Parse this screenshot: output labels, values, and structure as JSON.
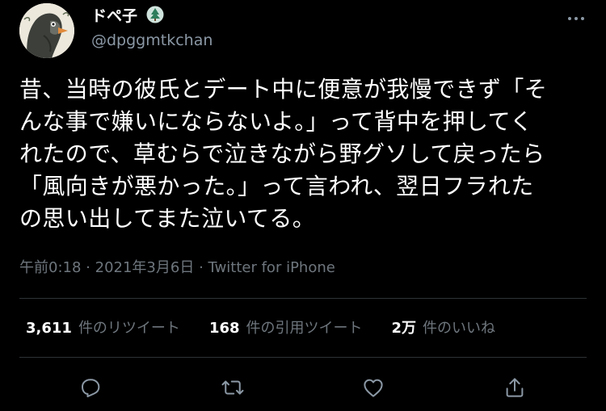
{
  "user": {
    "display_name": "ドペ子",
    "handle": "@dpggmtkchan"
  },
  "tweet": {
    "lines": [
      "昔、当時の彼氏とデート中に便意が我慢できず「そ",
      "んな事で嫌いにならないよ。」って背中を押してく",
      "れたので、草むらで泣きながら野グソして戻ったら",
      "「風向きが悪かった。」って言われ、翌日フラれた",
      "の思い出してまた泣いてる。"
    ]
  },
  "meta": {
    "time": "午前0:18",
    "date": "2021年3月6日",
    "separator": "·",
    "source": "Twitter for iPhone"
  },
  "stats": {
    "retweets": {
      "count": "3,611",
      "label": "件のリツイート"
    },
    "quotes": {
      "count": "168",
      "label": "件の引用ツイート"
    },
    "likes": {
      "count": "2万",
      "label": "件のいいね"
    }
  },
  "icons": {
    "more": "more-icon",
    "reply": "reply-icon",
    "retweet": "retweet-icon",
    "like": "like-icon",
    "share": "share-icon"
  },
  "colors": {
    "background": "#000000",
    "text_primary": "#ffffff",
    "text_secondary": "#6e767d",
    "divider": "#2f3336"
  }
}
